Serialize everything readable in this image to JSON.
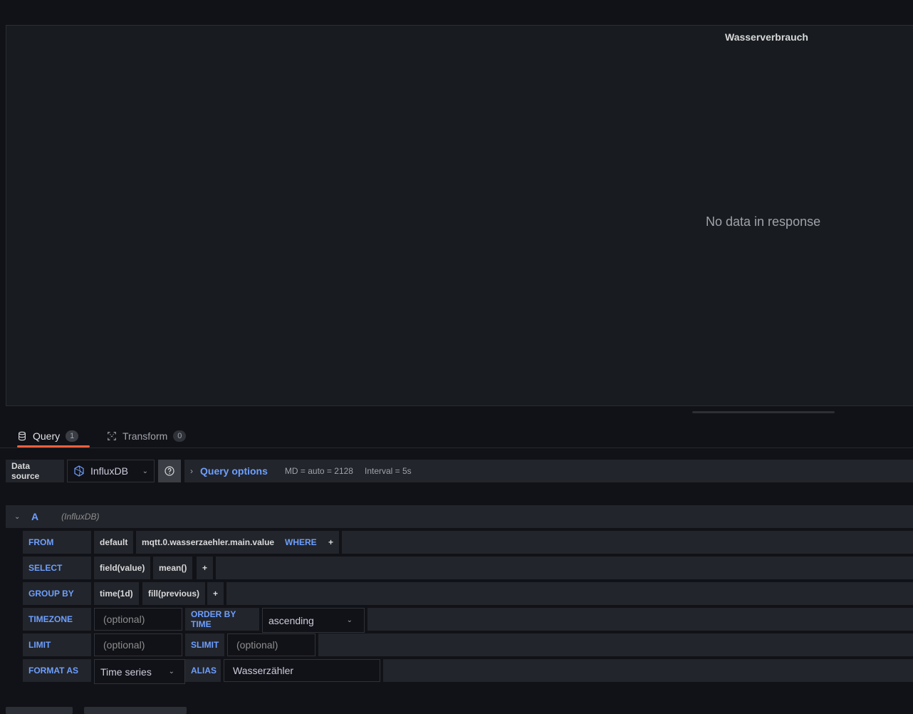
{
  "panel": {
    "title": "Wasserverbrauch",
    "message": "No data in response"
  },
  "tabs": [
    {
      "label": "Query",
      "count": "1",
      "active": true,
      "icon": "database-icon"
    },
    {
      "label": "Transform",
      "count": "0",
      "active": false,
      "icon": "transform-icon"
    }
  ],
  "datasource": {
    "label": "Data source",
    "selected": "InfluxDB",
    "help_icon": "question-circle-icon"
  },
  "query_options": {
    "title": "Query options",
    "max_data_points": "MD = auto = 2128",
    "interval": "Interval = 5s"
  },
  "query": {
    "ref_id": "A",
    "datasource_name": "(InfluxDB)",
    "from": {
      "keyword": "FROM",
      "policy": "default",
      "measurement": "mqtt.0.wasserzaehler.main.value",
      "where": "WHERE",
      "add": "+"
    },
    "select": {
      "keyword": "SELECT",
      "field": "field(value)",
      "func": "mean()",
      "add": "+"
    },
    "group_by": {
      "keyword": "GROUP BY",
      "time": "time(1d)",
      "fill": "fill(previous)",
      "add": "+"
    },
    "timezone": {
      "keyword": "TIMEZONE",
      "placeholder": "(optional)"
    },
    "order_by_time": {
      "keyword": "ORDER BY TIME",
      "value": "ascending"
    },
    "limit": {
      "keyword": "LIMIT",
      "placeholder": "(optional)"
    },
    "slimit": {
      "keyword": "SLIMIT",
      "placeholder": "(optional)"
    },
    "format_as": {
      "keyword": "FORMAT AS",
      "value": "Time series"
    },
    "alias": {
      "keyword": "ALIAS",
      "value": "Wasserzähler"
    }
  },
  "colors": {
    "accent": "#6e9fff",
    "tab_underline": "#f55f3e",
    "background": "#111217",
    "panel": "#181b1f"
  }
}
